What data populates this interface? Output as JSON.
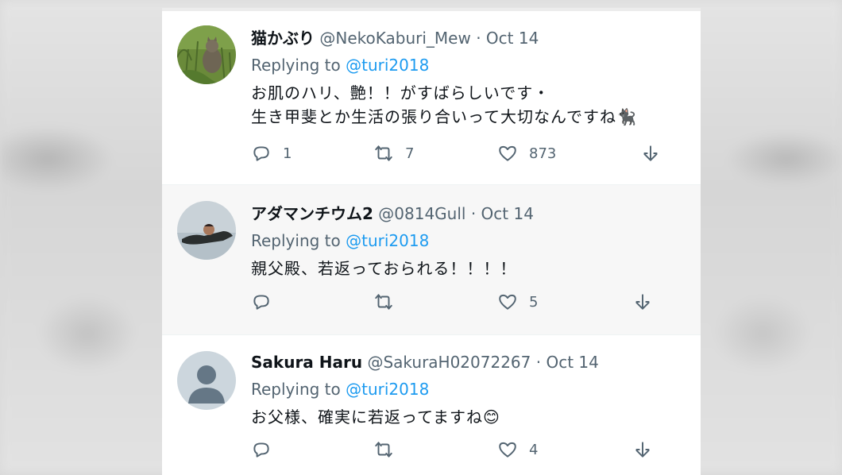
{
  "tweets": [
    {
      "name": "猫かぶり",
      "handle": "@NekoKaburi_Mew",
      "date": "· Oct 14",
      "replying_label": "Replying to",
      "replying_to": "@turi2018",
      "text_line1": "お肌のハリ、艶！！がすばらしいです・",
      "text_line2": "生き甲斐とか生活の張り合いって大切なんですね🐈‍⬛",
      "replies": "1",
      "retweets": "7",
      "likes": "873"
    },
    {
      "name": "アダマンチウム2",
      "handle": "@0814Gull",
      "date": "· Oct 14",
      "replying_label": "Replying to",
      "replying_to": "@turi2018",
      "text_line1": "親父殿、若返っておられる！！！！",
      "replies": "",
      "retweets": "",
      "likes": "5"
    },
    {
      "name": "Sakura Haru",
      "handle": "@SakuraH02072267",
      "date": "· Oct 14",
      "replying_label": "Replying to",
      "replying_to": "@turi2018",
      "text_line1": "お父様、確実に若返ってますね😊",
      "replies": "",
      "retweets": "",
      "likes": "4"
    }
  ],
  "icons": [
    "reply-icon",
    "retweet-icon",
    "like-icon",
    "share-icon"
  ],
  "colors": {
    "mention": "#1d9bf0",
    "secondary": "#536471",
    "primary": "#0f1419"
  }
}
